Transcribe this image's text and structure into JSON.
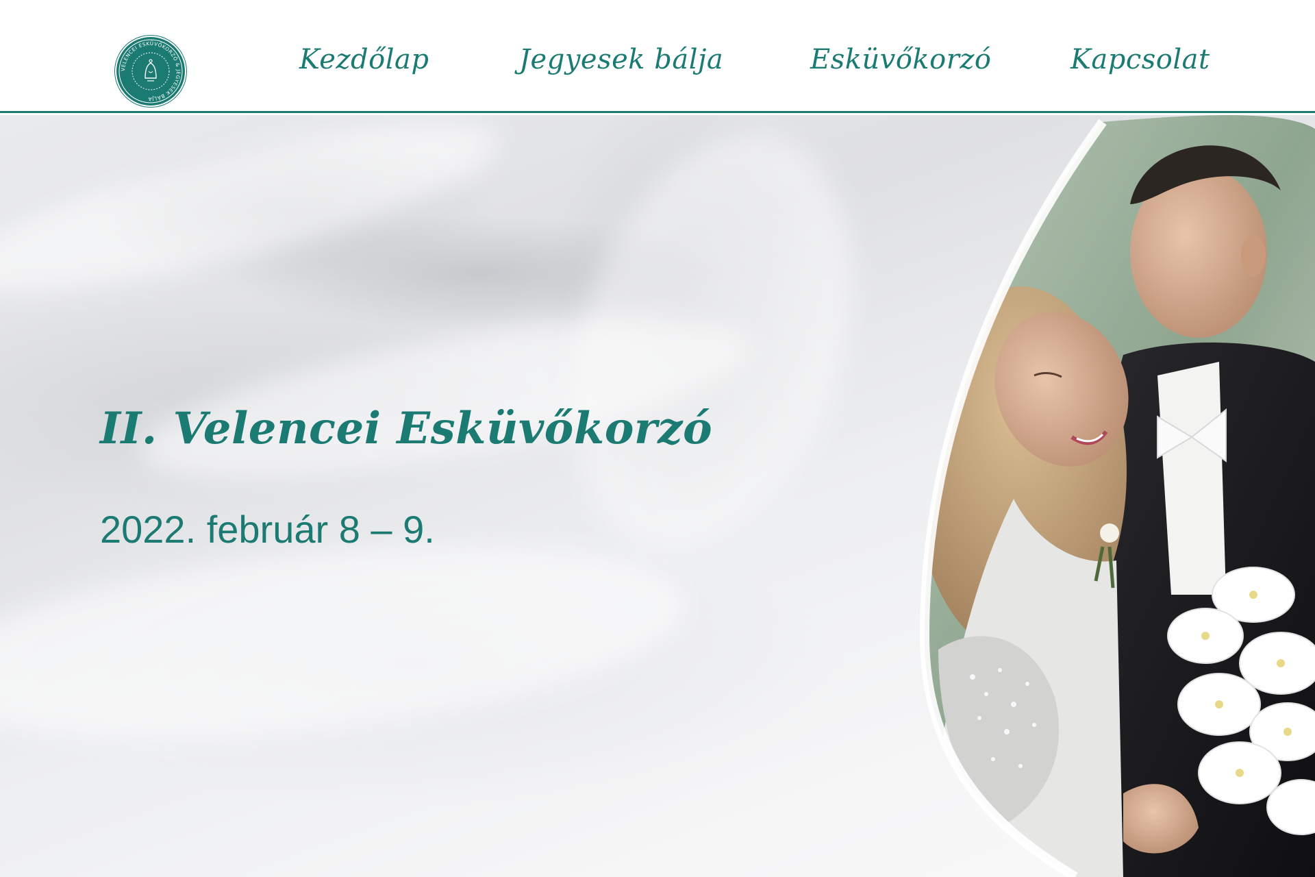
{
  "logo": {
    "text": "VELENCEI ESKÜVŐKORZÓ & JEGYESEK BÁLJA",
    "color": "#1b7a72"
  },
  "nav": {
    "items": [
      {
        "label": "Kezdőlap"
      },
      {
        "label": "Jegyesek bálja"
      },
      {
        "label": "Esküvőkorzó"
      },
      {
        "label": "Kapcsolat"
      }
    ]
  },
  "hero": {
    "title": "II. Velencei Esküvőkorzó",
    "date": "2022. február 8 – 9.",
    "photo": "wedding-couple-photo"
  },
  "colors": {
    "accent": "#1b7a72",
    "background": "#ffffff"
  }
}
